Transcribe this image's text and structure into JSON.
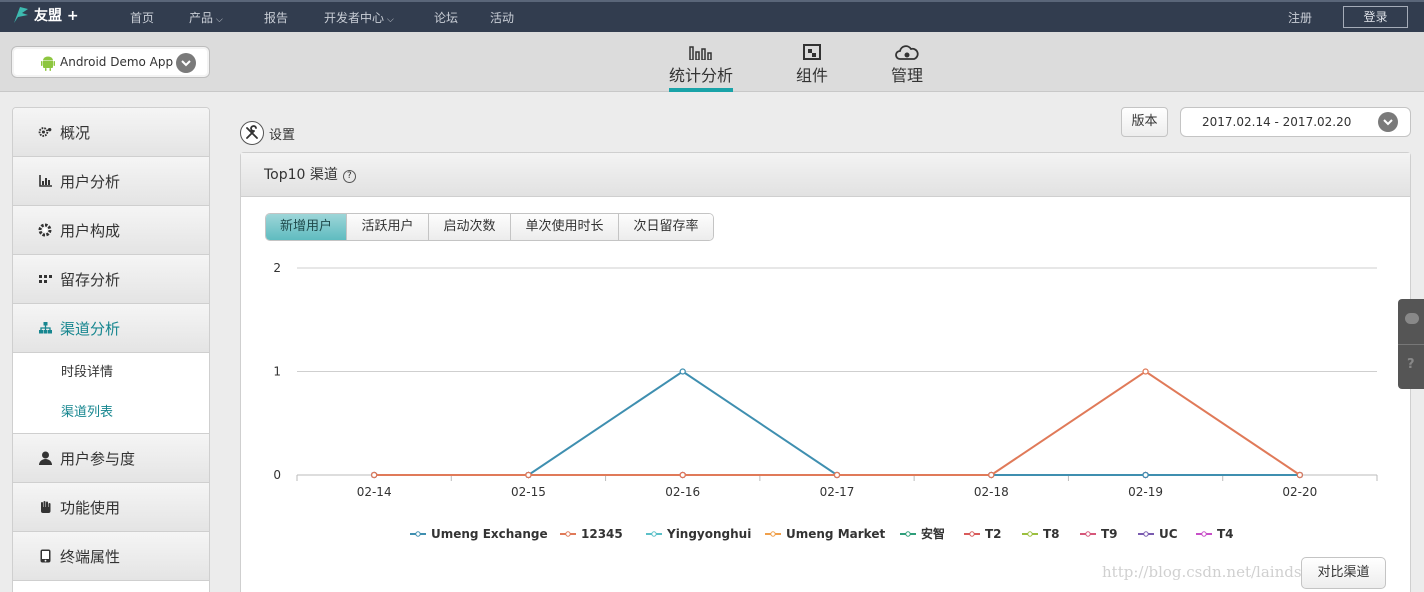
{
  "topnav": {
    "brand": "友盟 +",
    "items": [
      {
        "label": "首页",
        "caret": ""
      },
      {
        "label": "产品",
        "caret": "⌵"
      },
      {
        "label": "报告",
        "caret": ""
      },
      {
        "label": "开发者中心",
        "caret": "⌵"
      },
      {
        "label": "论坛",
        "caret": ""
      },
      {
        "label": "活动",
        "caret": ""
      }
    ],
    "register": "注册",
    "login": "登录"
  },
  "app_selector": {
    "name": "Android Demo App"
  },
  "tabs": [
    {
      "label": "统计分析",
      "icon": "bar-chart-icon",
      "active": true
    },
    {
      "label": "组件",
      "icon": "component-icon",
      "active": false
    },
    {
      "label": "管理",
      "icon": "cloud-gear-icon",
      "active": false
    }
  ],
  "sidebar": {
    "items": [
      {
        "label": "概况",
        "icon": "gears-icon"
      },
      {
        "label": "用户分析",
        "icon": "chart-icon"
      },
      {
        "label": "用户构成",
        "icon": "gear-icon"
      },
      {
        "label": "留存分析",
        "icon": "grid-icon"
      },
      {
        "label": "渠道分析",
        "icon": "hierarchy-icon"
      },
      {
        "label": "用户参与度",
        "icon": "person-icon"
      },
      {
        "label": "功能使用",
        "icon": "hand-icon"
      },
      {
        "label": "终端属性",
        "icon": "phone-icon"
      }
    ],
    "sub_items": [
      "时段详情",
      "渠道列表"
    ]
  },
  "settings_label": "设置",
  "version_label": "版本",
  "date_range": "2017.02.14 - 2017.02.20",
  "panel": {
    "title": "Top10 渠道",
    "help": "?",
    "segments": [
      "新增用户",
      "活跃用户",
      "启动次数",
      "单次使用时长",
      "次日留存率"
    ]
  },
  "compare_button": "对比渠道",
  "watermark": "http://blog.csdn.net/lainds",
  "chart_data": {
    "type": "line",
    "x": [
      "02-14",
      "02-15",
      "02-16",
      "02-17",
      "02-18",
      "02-19",
      "02-20"
    ],
    "ylim": [
      0,
      2
    ],
    "yticks": [
      0,
      1,
      2
    ],
    "grid": true,
    "legend_position": "bottom",
    "series": [
      {
        "name": "Umeng Exchange",
        "color": "#3f8fb0",
        "values": [
          0,
          0,
          1,
          0,
          0,
          0,
          0
        ]
      },
      {
        "name": "12345",
        "color": "#e07a59",
        "values": [
          0,
          0,
          0,
          0,
          0,
          1,
          0
        ]
      },
      {
        "name": "Yingyonghui",
        "color": "#5bc0c8",
        "values": [
          0,
          0,
          0,
          0,
          0,
          0,
          0
        ]
      },
      {
        "name": "Umeng Market",
        "color": "#f0a04b",
        "values": [
          0,
          0,
          0,
          0,
          0,
          0,
          0
        ]
      },
      {
        "name": "安智",
        "color": "#2f9e7a",
        "values": [
          0,
          0,
          0,
          0,
          0,
          0,
          0
        ]
      },
      {
        "name": "T2",
        "color": "#d95b5b",
        "values": [
          0,
          0,
          0,
          0,
          0,
          0,
          0
        ]
      },
      {
        "name": "T8",
        "color": "#9bbf3f",
        "values": [
          0,
          0,
          0,
          0,
          0,
          0,
          0
        ]
      },
      {
        "name": "T9",
        "color": "#d6577a",
        "values": [
          0,
          0,
          0,
          0,
          0,
          0,
          0
        ]
      },
      {
        "name": "UC",
        "color": "#7a5bb0",
        "values": [
          0,
          0,
          0,
          0,
          0,
          0,
          0
        ]
      },
      {
        "name": "T4",
        "color": "#c84fc8",
        "values": [
          0,
          0,
          0,
          0,
          0,
          0,
          0
        ]
      }
    ]
  }
}
